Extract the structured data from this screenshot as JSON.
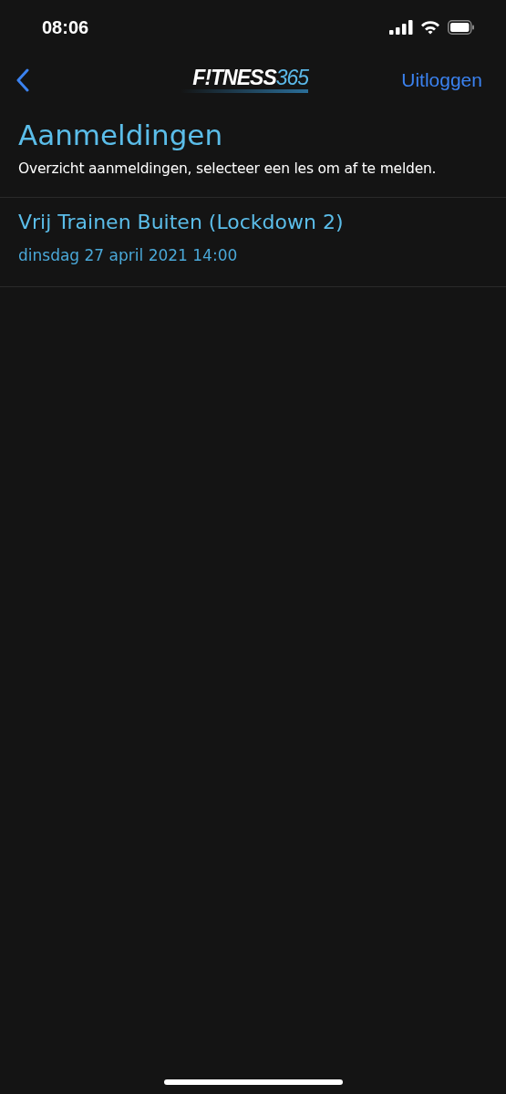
{
  "status_bar": {
    "time": "08:06"
  },
  "nav": {
    "logo": {
      "main": "F!TNESS",
      "accent": "365"
    },
    "action": "Uitloggen"
  },
  "page": {
    "title": "Aanmeldingen",
    "subtitle": "Overzicht aanmeldingen, selecteer een les om af te melden."
  },
  "registrations": [
    {
      "title": "Vrij Trainen Buiten (Lockdown 2)",
      "date": "dinsdag 27 april 2021 14:00"
    }
  ]
}
